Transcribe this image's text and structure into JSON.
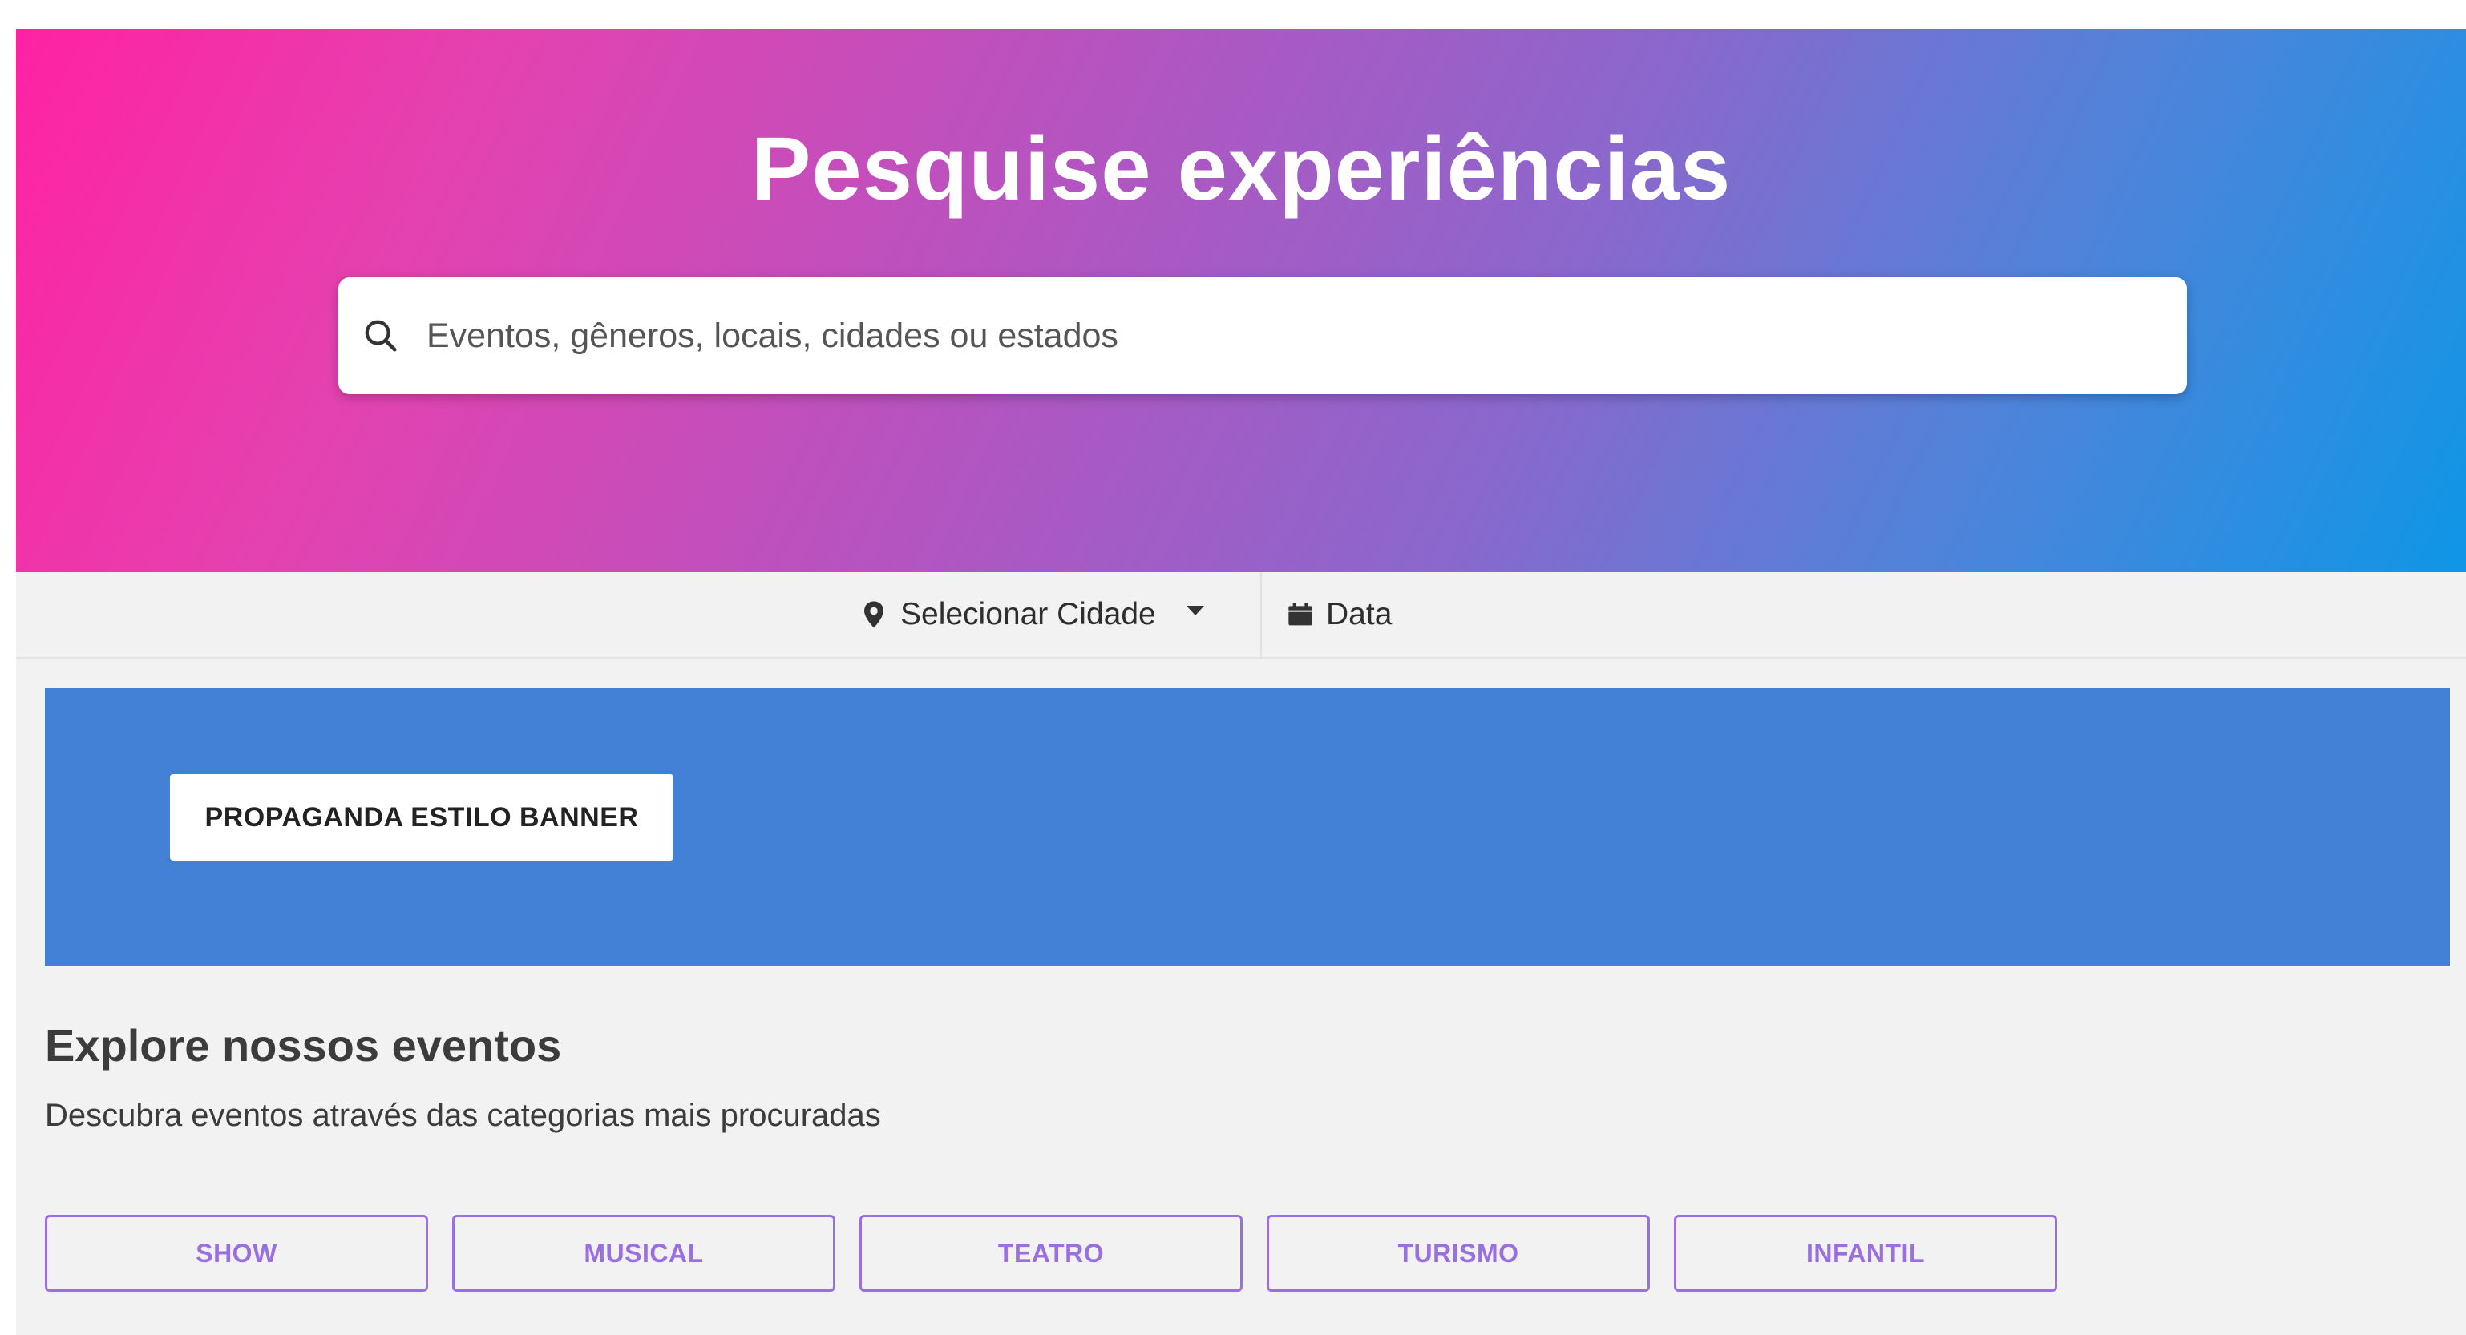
{
  "hero": {
    "title": "Pesquise experiências",
    "search": {
      "placeholder": "Eventos, gêneros, locais, cidades ou estados",
      "value": "",
      "icon": "search-icon"
    },
    "gradient_colors": [
      "#ff22a2",
      "#b355c1",
      "#0f96e6"
    ]
  },
  "filters": {
    "city": {
      "label": "Selecionar Cidade",
      "icon": "map-pin-icon",
      "dropdown_icon": "caret-down-icon"
    },
    "date": {
      "label": "Data",
      "icon": "calendar-icon"
    }
  },
  "banner": {
    "button_label": "PROPAGANDA ESTILO BANNER",
    "background_color": "#4281d6"
  },
  "explore": {
    "title": "Explore nossos eventos",
    "subtitle": "Descubra eventos através das categorias mais procuradas",
    "categories": [
      "SHOW",
      "MUSICAL",
      "TEATRO",
      "TURISMO",
      "INFANTIL"
    ],
    "accent_color": "#9a6fe1"
  }
}
